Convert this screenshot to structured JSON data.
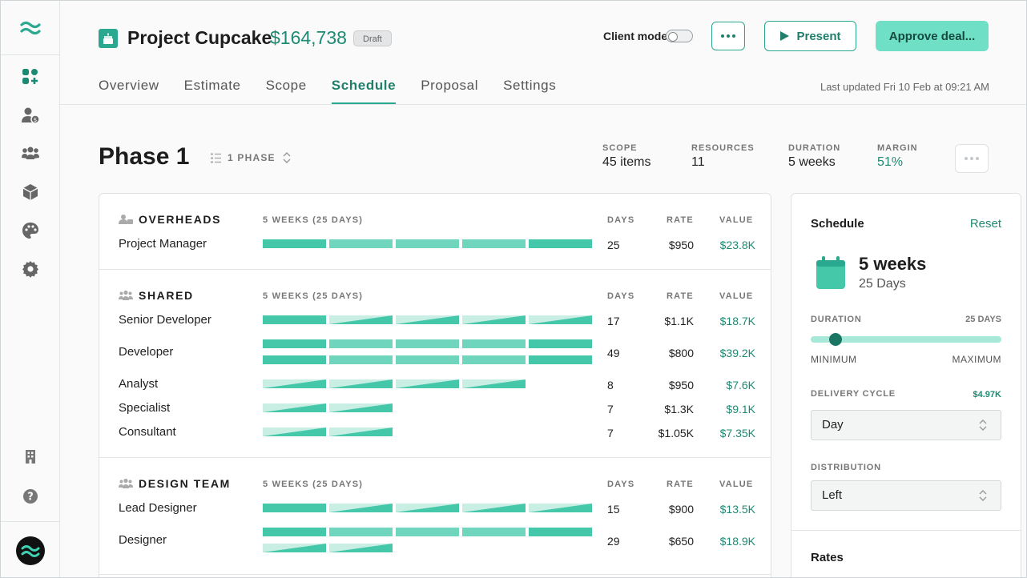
{
  "header": {
    "title": "Project Cupcake",
    "price": "$164,738",
    "status_badge": "Draft",
    "client_mode_label": "Client mode",
    "present_label": "Present",
    "approve_label": "Approve deal...",
    "last_updated": "Last updated Fri 10 Feb at 09:21 AM"
  },
  "tabs": [
    "Overview",
    "Estimate",
    "Scope",
    "Schedule",
    "Proposal",
    "Settings"
  ],
  "active_tab": "Schedule",
  "sidebar": {
    "icons": [
      "dashboard-icon",
      "client-billing-icon",
      "team-icon",
      "product-box-icon",
      "palette-icon",
      "settings-gear-icon",
      "building-icon",
      "help-icon"
    ]
  },
  "phase": {
    "title": "Phase 1",
    "phase_count": "1 PHASE",
    "stats": [
      {
        "label": "SCOPE",
        "value": "45 items"
      },
      {
        "label": "RESOURCES",
        "value": "11"
      },
      {
        "label": "DURATION",
        "value": "5 weeks"
      },
      {
        "label": "MARGIN",
        "value": "51%"
      }
    ]
  },
  "columns": {
    "duration": "5 WEEKS (25 DAYS)",
    "days": "DAYS",
    "rate": "RATE",
    "value": "VALUE"
  },
  "sections": [
    {
      "name": "OVERHEADS",
      "rows": [
        {
          "role": "Project Manager",
          "days": "25",
          "rate": "$950",
          "value": "$23.8K"
        }
      ]
    },
    {
      "name": "SHARED",
      "rows": [
        {
          "role": "Senior Developer",
          "days": "17",
          "rate": "$1.1K",
          "value": "$18.7K"
        },
        {
          "role": "Developer",
          "days": "49",
          "rate": "$800",
          "value": "$39.2K"
        },
        {
          "role": "Analyst",
          "days": "8",
          "rate": "$950",
          "value": "$7.6K"
        },
        {
          "role": "Specialist",
          "days": "7",
          "rate": "$1.3K",
          "value": "$9.1K"
        },
        {
          "role": "Consultant",
          "days": "7",
          "rate": "$1.05K",
          "value": "$7.35K"
        }
      ]
    },
    {
      "name": "DESIGN TEAM",
      "rows": [
        {
          "role": "Lead Designer",
          "days": "15",
          "rate": "$900",
          "value": "$13.5K"
        },
        {
          "role": "Designer",
          "days": "29",
          "rate": "$650",
          "value": "$18.9K"
        }
      ]
    }
  ],
  "panel": {
    "title": "Schedule",
    "reset_label": "Reset",
    "weeks": "5 weeks",
    "days": "25 Days",
    "duration_label": "DURATION",
    "duration_value": "25 DAYS",
    "slider_fraction": 0.13,
    "min_label": "MINIMUM",
    "max_label": "MAXIMUM",
    "delivery_cycle_label": "DELIVERY CYCLE",
    "delivery_cycle_value": "$4.97K",
    "delivery_cycle_selected": "Day",
    "distribution_label": "DISTRIBUTION",
    "distribution_selected": "Left",
    "rates_label": "Rates"
  },
  "colors": {
    "accent": "#2aa890",
    "accent_text": "#1f8a73",
    "approve_bg": "#6fe0c6",
    "bar_full": "#45c7a9",
    "bar_light": "#c9efe5"
  }
}
